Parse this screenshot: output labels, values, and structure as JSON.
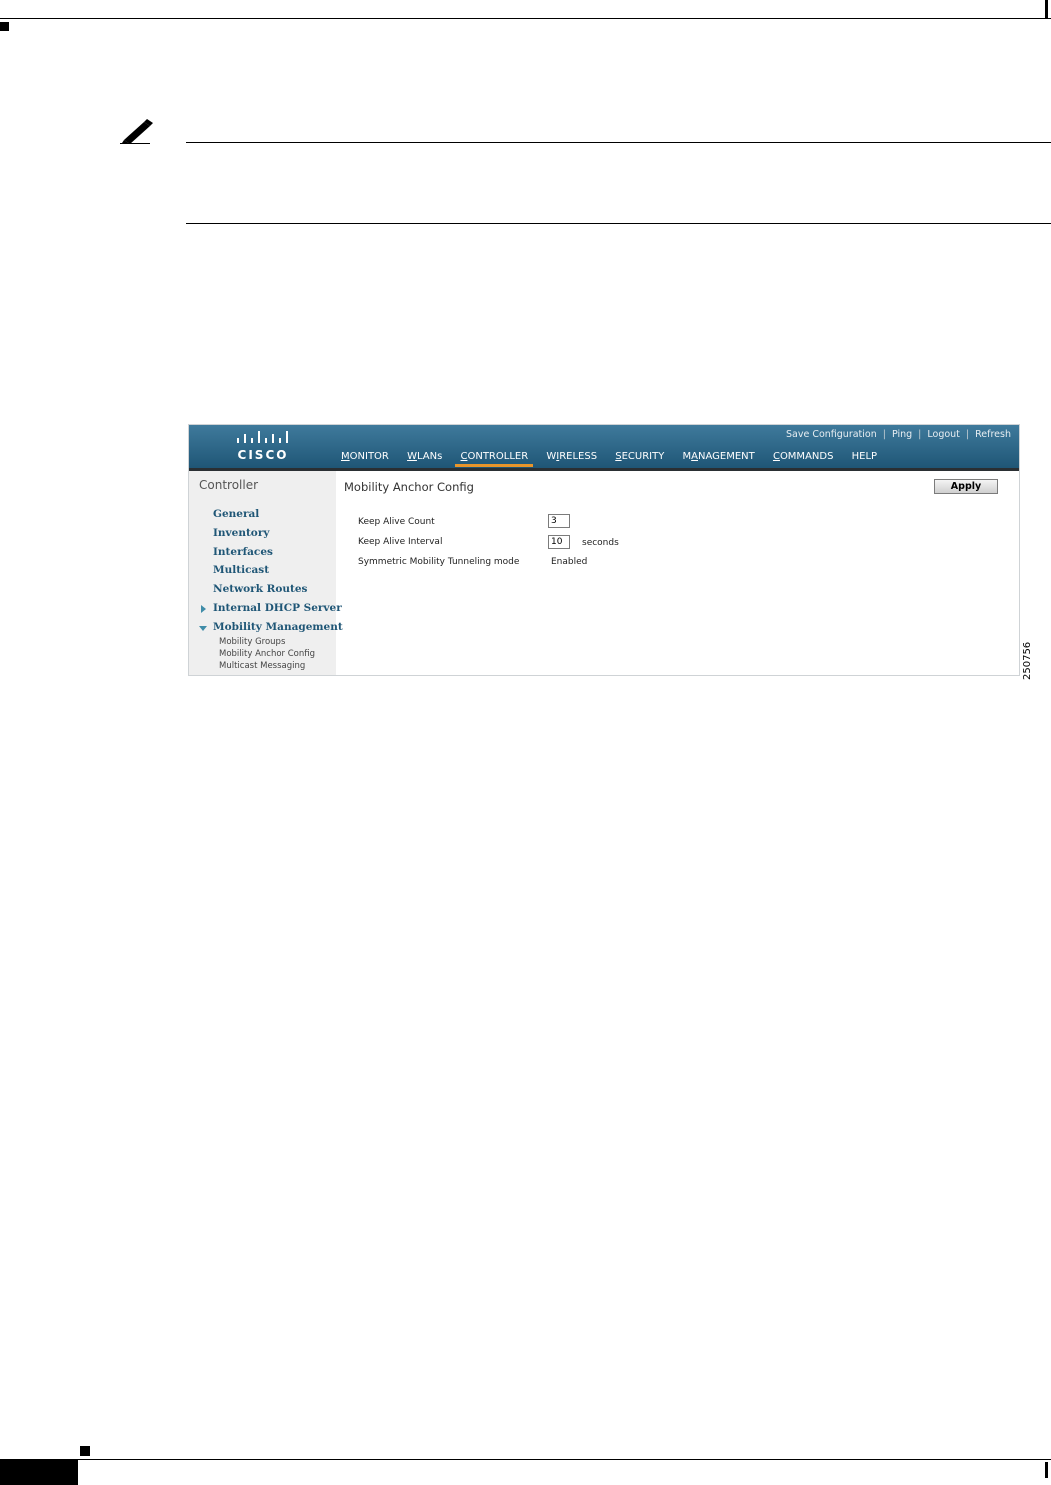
{
  "figure_number": "250756",
  "header": {
    "logo_text": "CISCO",
    "util_links": [
      "Save Configuration",
      "Ping",
      "Logout",
      "Refresh"
    ],
    "nav": [
      {
        "label": "MONITOR",
        "u": "M",
        "rest": "ONITOR"
      },
      {
        "label": "WLANs",
        "u": "W",
        "rest": "LANs"
      },
      {
        "label": "CONTROLLER",
        "u": "C",
        "rest": "ONTROLLER",
        "active": true
      },
      {
        "label": "WIRELESS",
        "pre": "W",
        "u": "I",
        "rest": "RELESS"
      },
      {
        "label": "SECURITY",
        "u": "S",
        "rest": "ECURITY"
      },
      {
        "label": "MANAGEMENT",
        "pre": "M",
        "u": "A",
        "rest": "NAGEMENT"
      },
      {
        "label": "COMMANDS",
        "u": "C",
        "rest": "OMMANDS"
      },
      {
        "label": "HELP",
        "u": "",
        "rest": "HELP"
      }
    ]
  },
  "sidebar": {
    "title": "Controller",
    "items": [
      "General",
      "Inventory",
      "Interfaces",
      "Multicast",
      "Network Routes",
      "Internal DHCP Server",
      "Mobility Management"
    ],
    "subitems": [
      "Mobility Groups",
      "Mobility Anchor Config",
      "Multicast Messaging"
    ]
  },
  "main": {
    "title": "Mobility Anchor Config",
    "apply_label": "Apply",
    "keep_alive_count_label": "Keep Alive Count",
    "keep_alive_count_value": "3",
    "keep_alive_interval_label": "Keep Alive Interval",
    "keep_alive_interval_value": "10",
    "keep_alive_interval_unit": "seconds",
    "symmetric_label": "Symmetric Mobility Tunneling mode",
    "symmetric_value": "Enabled"
  },
  "colors": {
    "banner": "#1f5676",
    "active_tab_underline": "#e8952b",
    "sidebar_link": "#1f5676",
    "sidebar_bg": "#efefef"
  },
  "icons": {
    "note": "pencil-note-icon",
    "expand_collapsed": "triangle-right-icon",
    "expand_open": "triangle-down-icon",
    "logo": "cisco-bars-logo"
  }
}
